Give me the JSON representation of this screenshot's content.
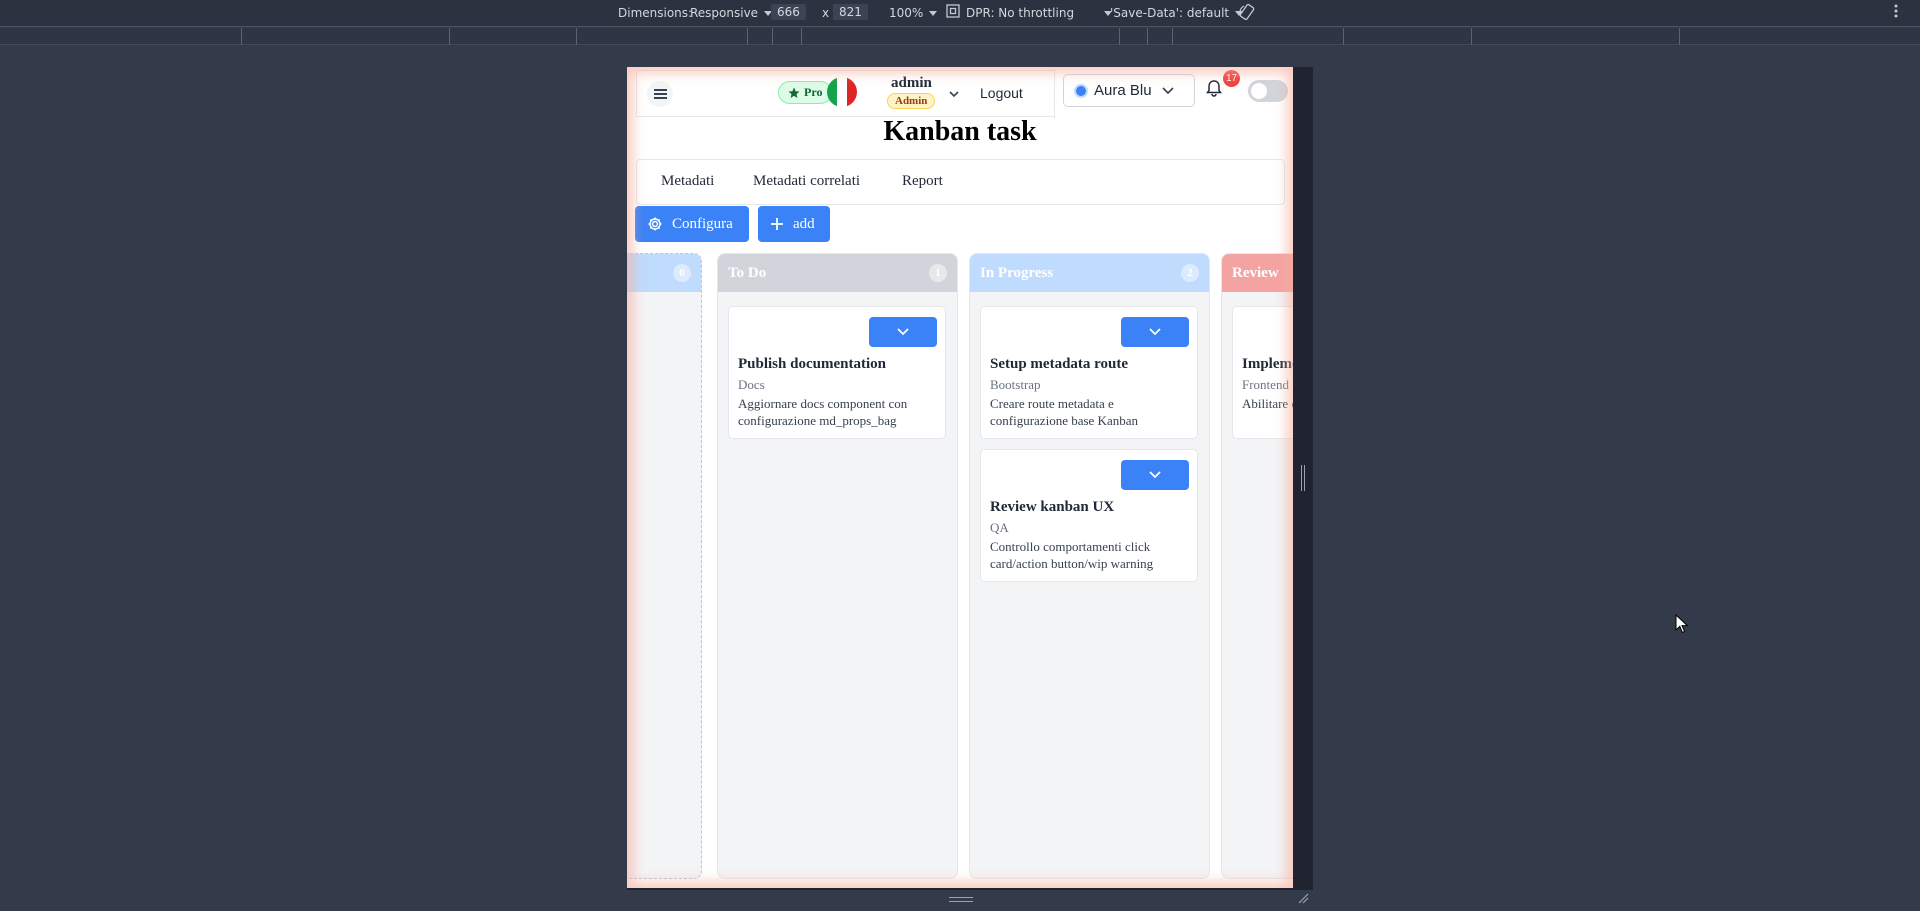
{
  "devtools": {
    "dimensions_label": "Dimensions:",
    "dimensions_mode": "Responsive",
    "width": "666",
    "times": "x",
    "height": "821",
    "zoom": "100%",
    "dpr": "DPR: No throttling",
    "save_data": "'Save-Data': default"
  },
  "header": {
    "pro_label": "Pro",
    "user_name": "admin",
    "user_role": "Admin",
    "logout_label": "Logout",
    "theme_value": "Aura Blu",
    "notification_count": "17",
    "theme_toggle_on": false
  },
  "page": {
    "title": "Kanban task"
  },
  "tabs": [
    "Metadati",
    "Metadati correlati",
    "Report"
  ],
  "toolbar": {
    "configure_label": "Configura",
    "add_label": "add"
  },
  "board": {
    "columns": [
      {
        "title": "",
        "count": "0",
        "color": "#bfdbfe"
      },
      {
        "title": "To Do",
        "count": "1",
        "color": "#d1d5db"
      },
      {
        "title": "In Progress",
        "count": "2",
        "color": "#bfdbfe"
      },
      {
        "title": "Review",
        "count": "",
        "color": "#fca5a5"
      }
    ],
    "cards": {
      "todo_0": {
        "title": "Publish documentation",
        "tag": "Docs",
        "description": "Aggiornare docs component con configurazione md_props_bag"
      },
      "inprogress_0": {
        "title": "Setup metadata route",
        "tag": "Bootstrap",
        "description": "Creare route metadata e configurazione base Kanban"
      },
      "inprogress_1": {
        "title": "Review kanban UX",
        "tag": "QA",
        "description": "Controllo comportamenti click card/action button/wip warning"
      },
      "review_0": {
        "title": "Implement",
        "tag": "Frontend",
        "description": "Abilitare con per"
      }
    }
  }
}
